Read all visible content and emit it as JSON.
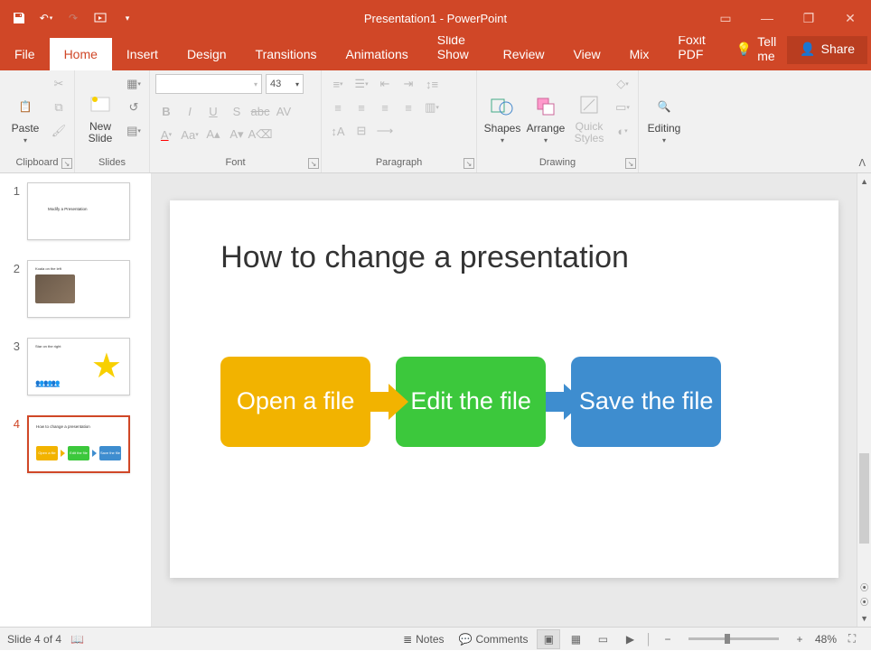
{
  "titlebar": {
    "title": "Presentation1 - PowerPoint"
  },
  "tabs": {
    "file": "File",
    "items": [
      "Home",
      "Insert",
      "Design",
      "Transitions",
      "Animations",
      "Slide Show",
      "Review",
      "View",
      "Mix",
      "Foxit PDF"
    ],
    "active": "Home",
    "tellme": "Tell me",
    "share": "Share"
  },
  "ribbon": {
    "clipboard": {
      "label": "Clipboard",
      "paste": "Paste"
    },
    "slides": {
      "label": "Slides",
      "new_slide": "New\nSlide"
    },
    "font": {
      "label": "Font",
      "size": "43"
    },
    "paragraph": {
      "label": "Paragraph"
    },
    "drawing": {
      "label": "Drawing",
      "shapes": "Shapes",
      "arrange": "Arrange",
      "quick_styles": "Quick\nStyles"
    },
    "editing": {
      "label": "Editing",
      "editing_btn": "Editing"
    }
  },
  "thumbs": [
    "1",
    "2",
    "3",
    "4"
  ],
  "slide": {
    "title": "How to change a presentation",
    "box1": "Open a file",
    "box2": "Edit the file",
    "box3": "Save the file"
  },
  "thumb_preview": {
    "t1_title": "Modify a Presentation",
    "t2_title": "Koala on the left",
    "t3_title": "Star on the right",
    "t4_title": "How to change a presentation",
    "t4_b1": "Open a file",
    "t4_b2": "Edit the file",
    "t4_b3": "Save the file"
  },
  "status": {
    "slide_of": "Slide 4 of 4",
    "notes": "Notes",
    "comments": "Comments",
    "zoom": "48%"
  }
}
